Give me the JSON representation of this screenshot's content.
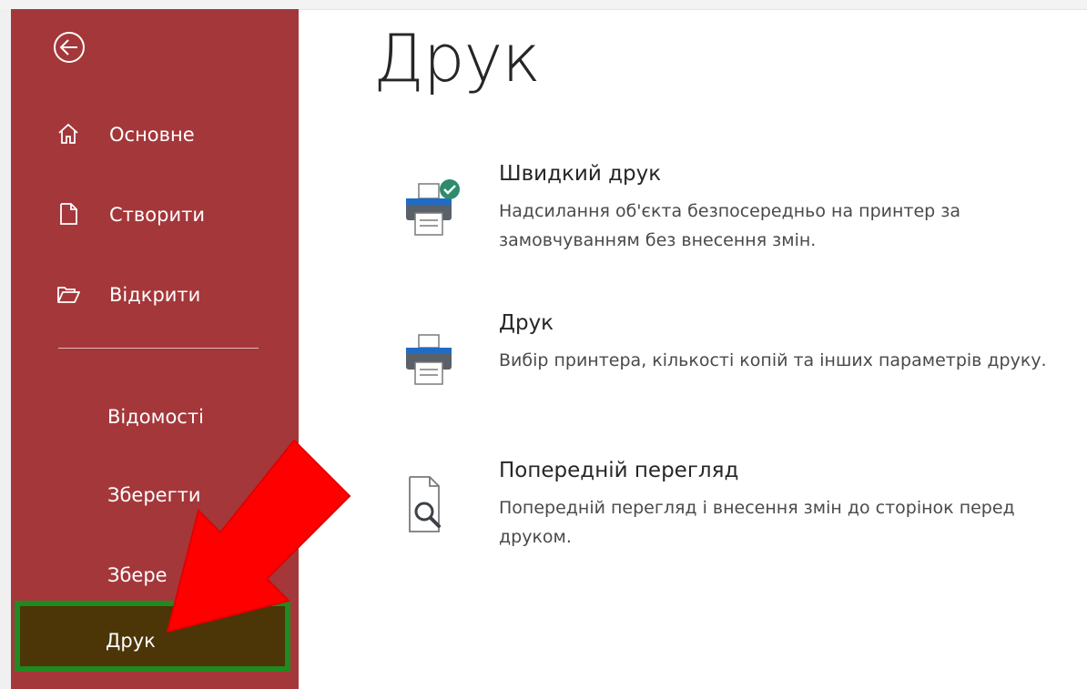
{
  "sidebar": {
    "back_icon": "back-arrow-circle-icon",
    "items": [
      {
        "label": "Основне",
        "icon": "home-icon"
      },
      {
        "label": "Створити",
        "icon": "new-document-icon"
      },
      {
        "label": "Відкрити",
        "icon": "open-folder-icon"
      },
      {
        "label": "Відомості"
      },
      {
        "label": "Зберегти"
      },
      {
        "label": "Збере"
      },
      {
        "label": "Друк"
      }
    ],
    "background_color": "#a4373a",
    "active_background": "#4c3507",
    "highlight_border_color": "#1f8a1f"
  },
  "annotation": {
    "arrow_color": "#ff0000"
  },
  "main": {
    "title": "Друк",
    "options": [
      {
        "title": "Швидкий друк",
        "description": "Надсилання об'єкта безпосередньо на принтер за замовчуванням без внесення змін.",
        "icon": "quick-print-icon"
      },
      {
        "title": "Друк",
        "description": "Вибір принтера, кількості копій та інших параметрів друку.",
        "icon": "printer-icon"
      },
      {
        "title": "Попередній перегляд",
        "description": "Попередній перегляд і внесення змін до сторінок перед друком.",
        "icon": "print-preview-icon"
      }
    ]
  }
}
